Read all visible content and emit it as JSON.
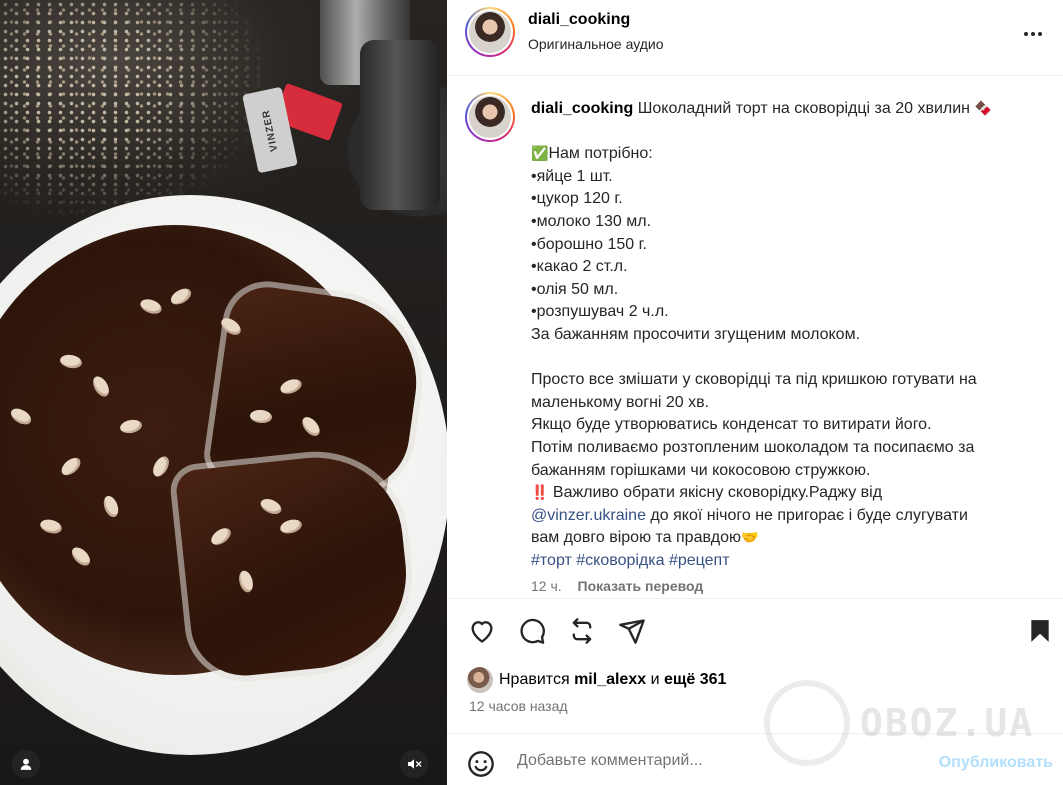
{
  "header": {
    "username": "diali_cooking",
    "audio_label": "Оригинальное аудио"
  },
  "media": {
    "brand_tag": "VINZER"
  },
  "caption": {
    "username": "diali_cooking",
    "title": "Шоколадний торт на сковорідці за 20 хвилин",
    "title_emoji": "🍫",
    "needed_emoji": "✅",
    "needed_label": "Нам потрібно:",
    "ingredients": [
      "•яйце 1 шт.",
      "•цукор 120 г.",
      "•молоко 130 мл.",
      "•борошно 150 г.",
      "•какао 2 ст.л.",
      "•олія 50 мл.",
      "•розпушувач 2 ч.л."
    ],
    "optional_note": "За бажанням просочити згущеним молоком.",
    "steps_1a": "Просто все змішати у сковорідці та під кришкою готувати на",
    "steps_1b": "маленькому вогні 20 хв.",
    "steps_2": "Якщо буде утворюватись конденсат то витирати його.",
    "steps_3a": "Потім поливаємо розтопленим шоколадом та посипаємо за",
    "steps_3b": "бажанням горішками чи кокосовою стружкою.",
    "warning_emoji": "‼️",
    "important_text": "Важливо обрати якісну сковорідку.Раджу від",
    "mention": "@vinzer.ukraine",
    "mention_after": "до якої нічого не пригорає і буде слугувати",
    "closing": "вам довго вірою та правдою",
    "closing_emoji": "🤝",
    "hashtags": [
      "#торт",
      "#сковорідка",
      "#рецепт"
    ],
    "time_ago": "12 ч.",
    "translate_label": "Показать перевод"
  },
  "likes": {
    "prefix": "Нравится",
    "liker": "mil_alexx",
    "conj": "и",
    "others": "ещё 361"
  },
  "posted": "12 часов назад",
  "comment": {
    "placeholder": "Добавьте комментарий...",
    "publish_label": "Опубликовать"
  },
  "watermark": "OBOZ.UA",
  "colors": {
    "link": "#385185",
    "publish_disabled": "#b2dffc",
    "secondary_text": "#737373"
  },
  "icons": [
    "heart-icon",
    "comment-icon",
    "repost-icon",
    "share-icon",
    "bookmark-icon",
    "emoji-smile-icon",
    "more-icon",
    "user-icon",
    "mute-icon"
  ]
}
